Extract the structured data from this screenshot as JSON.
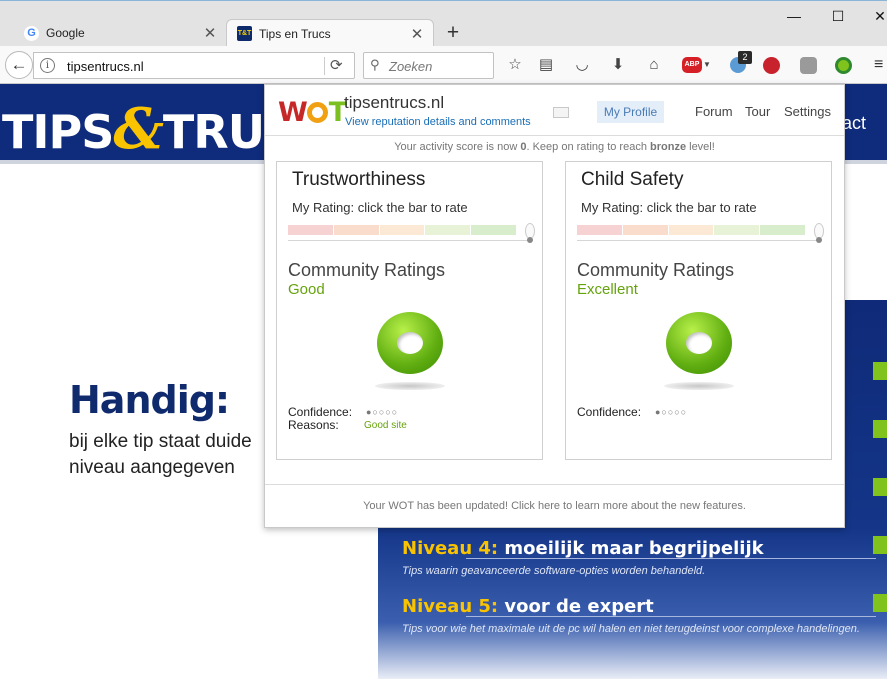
{
  "browser": {
    "tabs": [
      {
        "label": "Google",
        "favicon": "google-g-icon"
      },
      {
        "label": "Tips en Trucs",
        "favicon": "tipsentrucs-icon"
      }
    ],
    "url": "tipsentrucs.nl",
    "search_placeholder": "Zoeken",
    "notification_count": "2",
    "adblock_label": "ABP"
  },
  "page": {
    "logo_left": "TIPS",
    "logo_amp": "&",
    "logo_right": "TRUCS",
    "nav_partial": "act",
    "handig_title": "Handig:",
    "handig_line1": "bij elke tip staat duide",
    "handig_line2": "niveau aangegeven",
    "levels": [
      {
        "label": "Niveau 4:",
        "title": " moeilijk maar begrijpelijk",
        "subtitle": "Tips waarin geavanceerde software-opties worden behandeld."
      },
      {
        "label": "Niveau 5:",
        "title": " voor de expert",
        "subtitle": "Tips voor wie het maximale uit de pc wil halen en niet terugdeinst voor complexe handelingen."
      }
    ]
  },
  "wot": {
    "logo": {
      "w": "W",
      "t": "T"
    },
    "domain": "tipsentrucs.nl",
    "details_link": "View reputation details and comments",
    "profile_label": "My Profile",
    "links": {
      "forum": "Forum",
      "tour": "Tour",
      "settings": "Settings"
    },
    "activity_prefix": "Your activity score is now ",
    "activity_score": "0",
    "activity_mid": ".  Keep on rating to reach ",
    "activity_level": "bronze",
    "activity_suffix": " level!",
    "cards": [
      {
        "title": "Trustworthiness",
        "my_rating": "My Rating: click the bar to rate",
        "community_label": "Community Ratings",
        "verdict": "Good",
        "confidence_label": "Confidence:",
        "confidence_dots": "●○○○○",
        "reasons_label": "Reasons:",
        "reason": "Good site"
      },
      {
        "title": "Child Safety",
        "my_rating": "My Rating: click the bar to rate",
        "community_label": "Community Ratings",
        "verdict": "Excellent",
        "confidence_label": "Confidence:",
        "confidence_dots": "●○○○○"
      }
    ],
    "footer": "Your WOT has been updated! Click here to learn more about the new features.",
    "rating_colors": [
      "#f6d2d2",
      "#f9dccc",
      "#fbe9d6",
      "#e7f2d6",
      "#d8edcb"
    ]
  }
}
